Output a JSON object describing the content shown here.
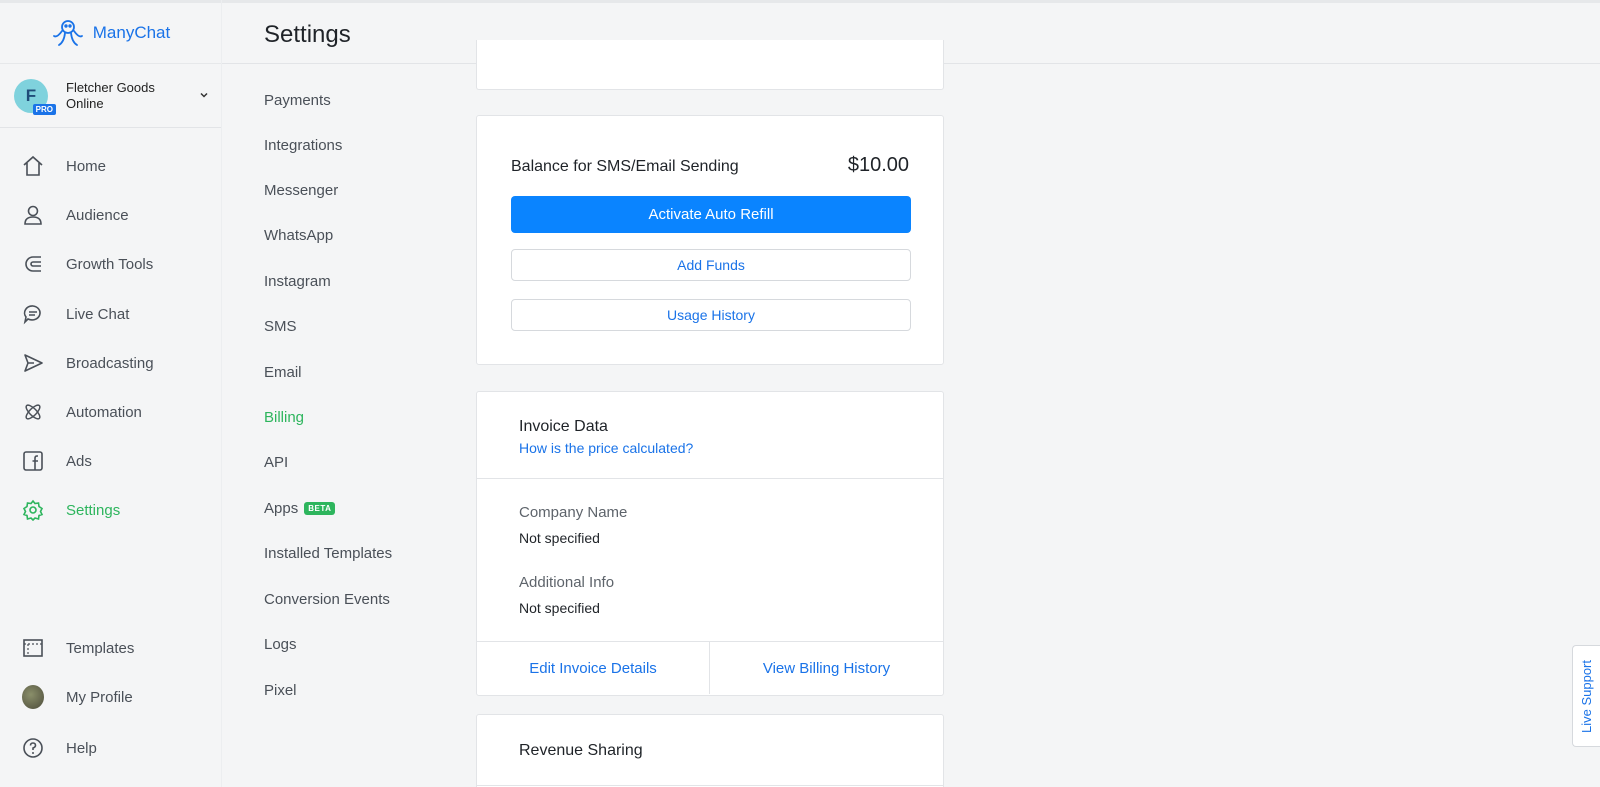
{
  "app": {
    "name": "ManyChat"
  },
  "account": {
    "initial": "F",
    "badge": "PRO",
    "name": "Fletcher Goods Online"
  },
  "nav": {
    "items": [
      {
        "label": "Home",
        "icon": "home-icon"
      },
      {
        "label": "Audience",
        "icon": "person-icon"
      },
      {
        "label": "Growth Tools",
        "icon": "magnet-icon"
      },
      {
        "label": "Live Chat",
        "icon": "chat-icon"
      },
      {
        "label": "Broadcasting",
        "icon": "send-icon"
      },
      {
        "label": "Automation",
        "icon": "automation-icon"
      },
      {
        "label": "Ads",
        "icon": "facebook-icon"
      },
      {
        "label": "Settings",
        "icon": "gear-icon",
        "active": true
      }
    ],
    "bottom": [
      {
        "label": "Templates",
        "icon": "templates-icon"
      },
      {
        "label": "My Profile",
        "icon": "profile-picture"
      },
      {
        "label": "Help",
        "icon": "help-icon"
      }
    ]
  },
  "header": {
    "title": "Settings"
  },
  "submenu": {
    "items": [
      "Payments",
      "Integrations",
      "Messenger",
      "WhatsApp",
      "Instagram",
      "SMS",
      "Email",
      "Billing",
      "API",
      "Apps",
      "Installed Templates",
      "Conversion Events",
      "Logs",
      "Pixel"
    ],
    "active": "Billing",
    "apps_badge": "BETA"
  },
  "balance": {
    "label": "Balance for SMS/Email Sending",
    "amount": "$10.00",
    "activate_label": "Activate Auto Refill",
    "add_funds_label": "Add Funds",
    "usage_history_label": "Usage History"
  },
  "invoice": {
    "title": "Invoice Data",
    "price_link": "How is the price calculated?",
    "company_label": "Company Name",
    "company_value": "Not specified",
    "info_label": "Additional Info",
    "info_value": "Not specified",
    "edit_label": "Edit Invoice Details",
    "history_label": "View Billing History"
  },
  "revenue": {
    "title": "Revenue Sharing"
  },
  "live_support": {
    "label": "Live Support"
  },
  "colors": {
    "accent_blue": "#0a84ff",
    "link_blue": "#1a73e8",
    "active_green": "#2db55d"
  }
}
